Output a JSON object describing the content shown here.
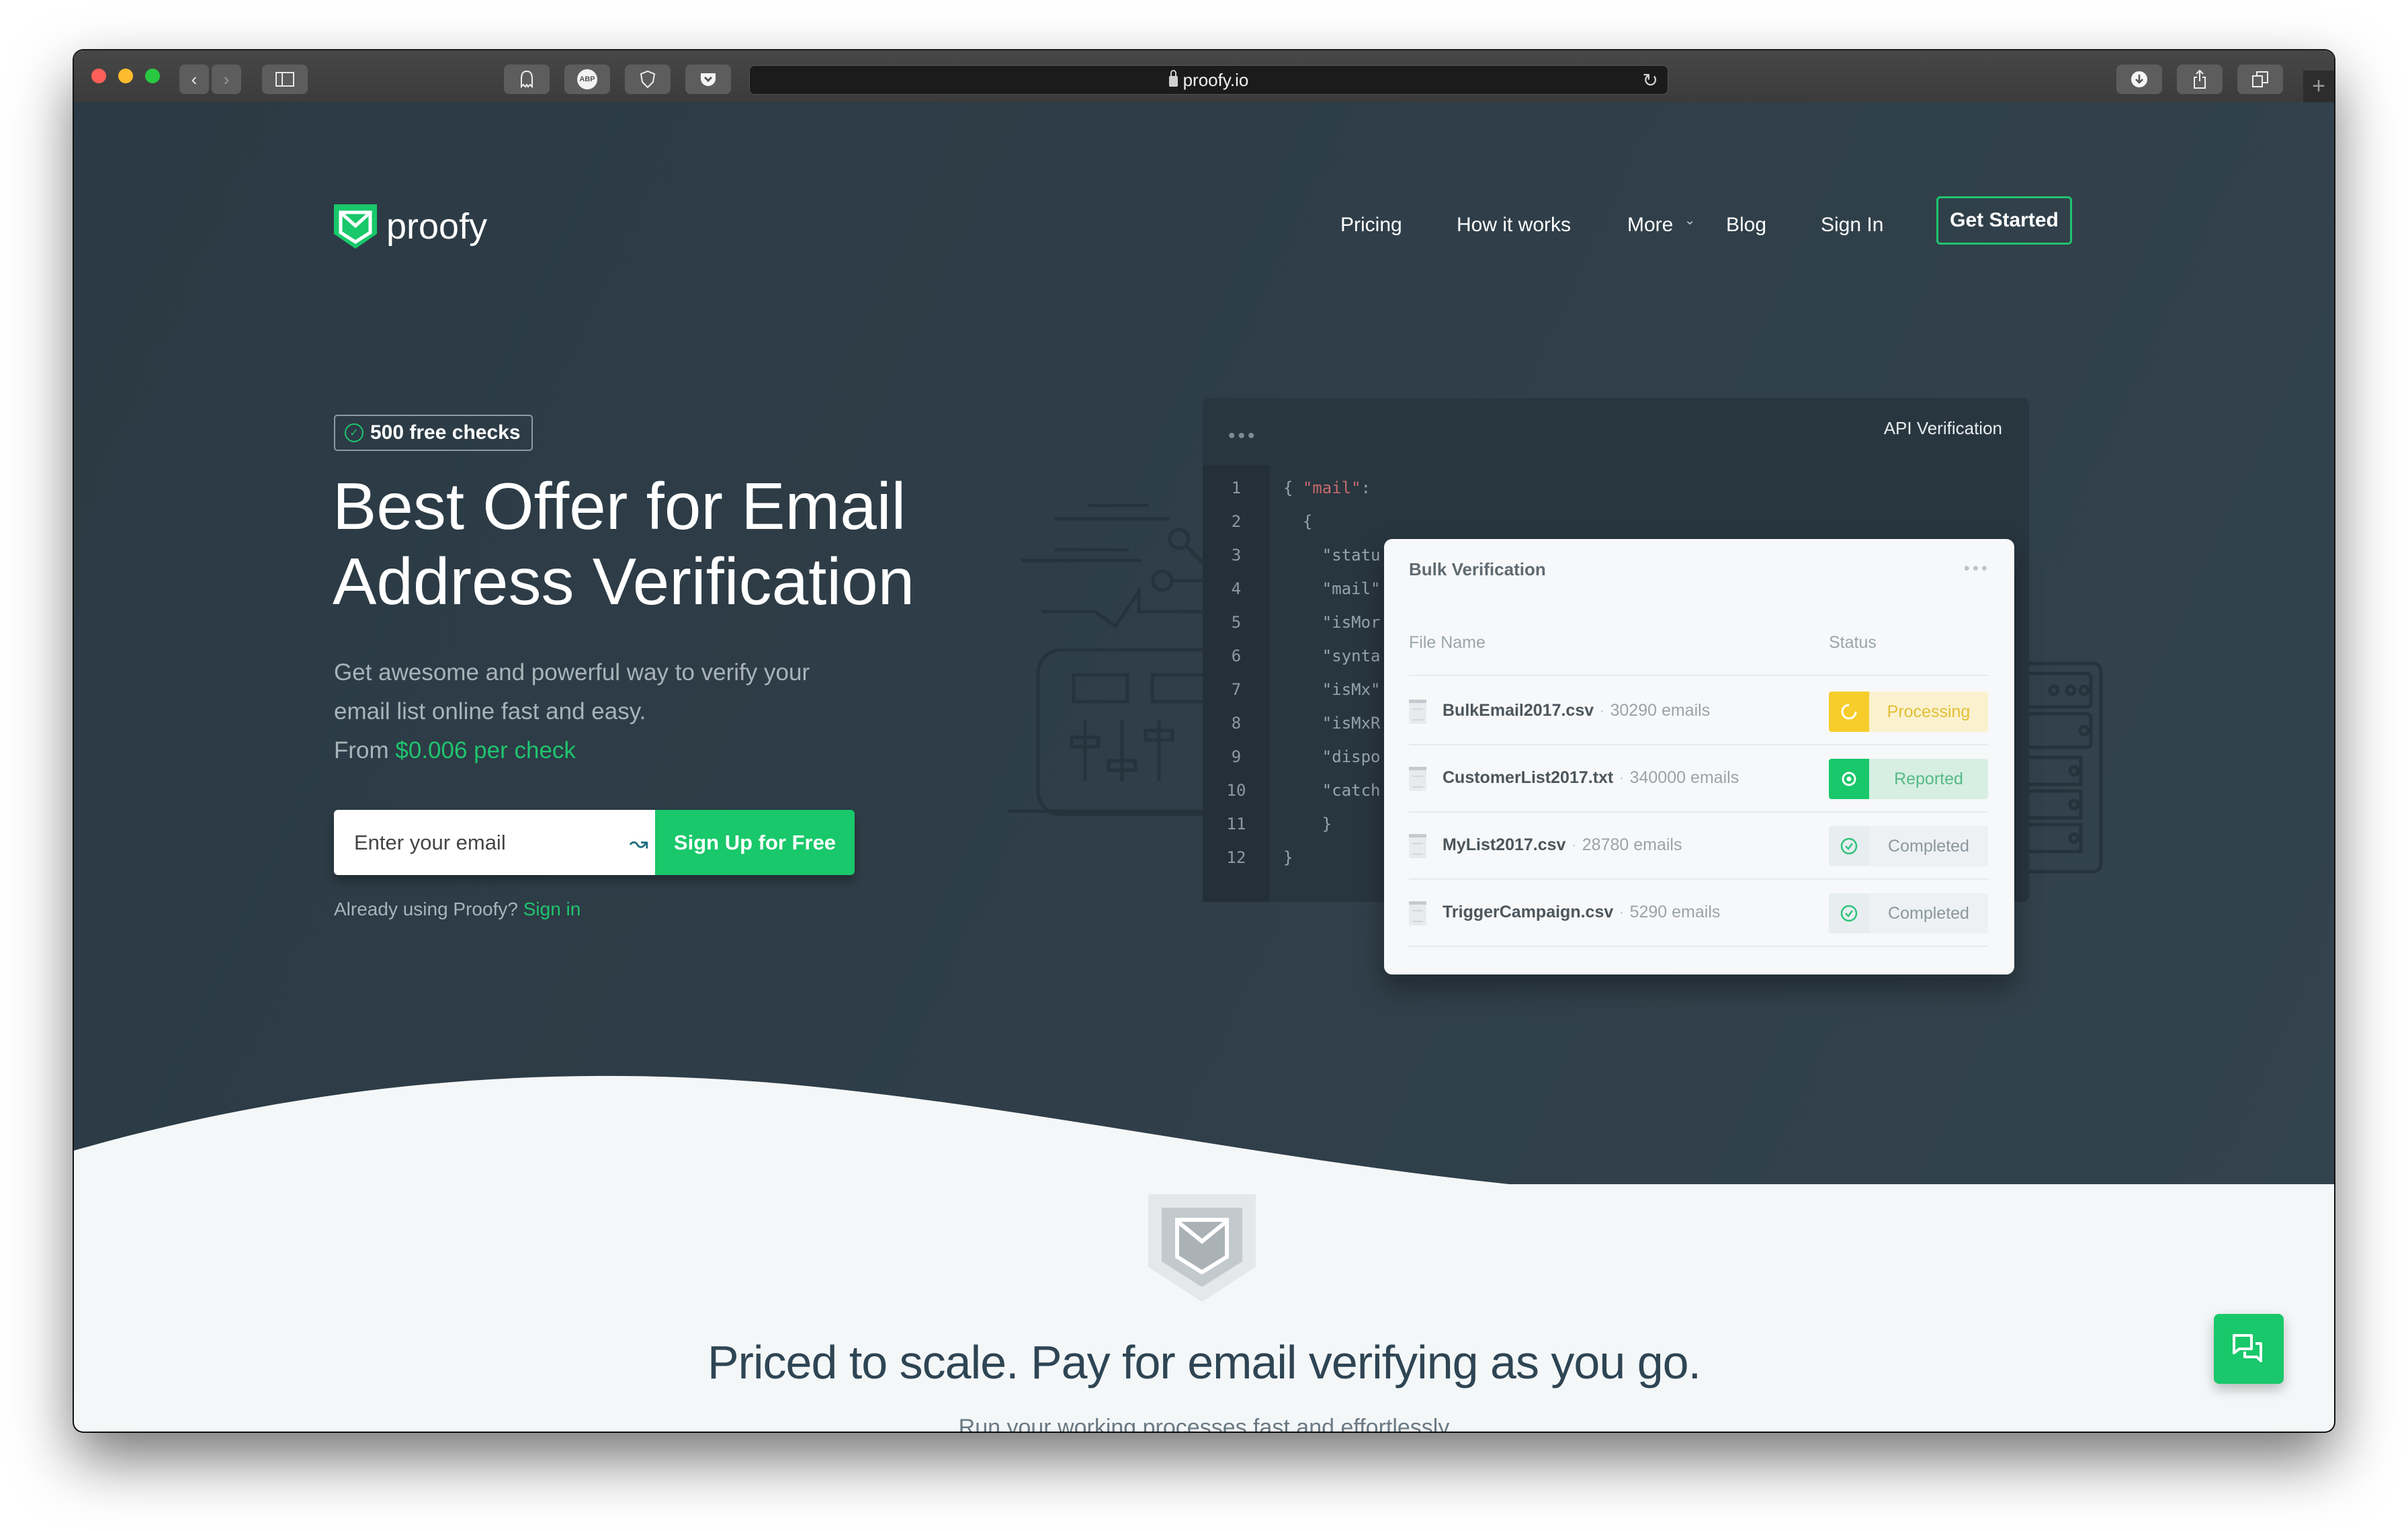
{
  "browser": {
    "url": "proofy.io",
    "extensions": [
      "ghostery-icon",
      "adblock-plus-icon",
      "privacy-shield-icon",
      "pocket-icon"
    ],
    "extension_labels": [
      "",
      "ABP",
      "",
      ""
    ],
    "toolbar_right": [
      "download-icon",
      "share-icon",
      "tabs-overview-icon"
    ]
  },
  "brand": {
    "name": "proofy",
    "accent": "#19c86a",
    "hero_bg": "#2e3d47"
  },
  "nav": {
    "items": [
      "Pricing",
      "How it works",
      "More",
      "Blog",
      "Sign In"
    ],
    "cta": "Get Started"
  },
  "hero": {
    "badge": "500 free checks",
    "headline_line1": "Best Offer for Email",
    "headline_line2": "Address Verification",
    "sub_line1": "Get awesome and powerful way to verify your",
    "sub_line2": "email list online fast and easy.",
    "price_prefix": "From ",
    "price": "$0.006 per check",
    "email_placeholder": "Enter your email",
    "signup_label": "Sign Up for Free",
    "already_text": "Already using Proofy? ",
    "signin_link": "Sign in"
  },
  "api_window": {
    "title": "API Verification",
    "line_numbers": [
      "1",
      "2",
      "3",
      "4",
      "5",
      "6",
      "7",
      "8",
      "9",
      "10",
      "11",
      "12"
    ],
    "code_lines": [
      {
        "pre": "{ ",
        "str": "\"mail\"",
        "post": ":"
      },
      {
        "pre": "  {",
        "str": "",
        "post": ""
      },
      {
        "pre": "    \"statu",
        "str": "",
        "post": ""
      },
      {
        "pre": "    \"mail\"",
        "str": "",
        "post": ""
      },
      {
        "pre": "    \"isMor",
        "str": "",
        "post": ""
      },
      {
        "pre": "    \"synta",
        "str": "",
        "post": ""
      },
      {
        "pre": "    \"isMx\"",
        "str": "",
        "post": ""
      },
      {
        "pre": "    \"isMxR",
        "str": "",
        "post": ""
      },
      {
        "pre": "    \"dispo",
        "str": "",
        "post": ""
      },
      {
        "pre": "    \"catch",
        "str": "",
        "post": ""
      },
      {
        "pre": "    }",
        "str": "",
        "post": ""
      },
      {
        "pre": "}",
        "str": "",
        "post": ""
      }
    ]
  },
  "bulk": {
    "title": "Bulk Verification",
    "columns": [
      "File Name",
      "Status"
    ],
    "rows": [
      {
        "file": "BulkEmail2017.csv",
        "count": "30290 emails",
        "status": "Processing",
        "kind": "processing"
      },
      {
        "file": "CustomerList2017.txt",
        "count": "340000 emails",
        "status": "Reported",
        "kind": "reported"
      },
      {
        "file": "MyList2017.csv",
        "count": "28780 emails",
        "status": "Completed",
        "kind": "completed"
      },
      {
        "file": "TriggerCampaign.csv",
        "count": "5290 emails",
        "status": "Completed",
        "kind": "completed"
      }
    ],
    "status_colors": {
      "processing": {
        "icon_bg": "#f7cd2c",
        "label_bg": "#fbf1cf",
        "label_fg": "#e1c032"
      },
      "reported": {
        "icon_bg": "#19c86a",
        "label_bg": "#d6efe2",
        "label_fg": "#56b887"
      },
      "completed": {
        "icon_bg": "#e8eef0",
        "label_bg": "#edf1f3",
        "label_fg": "#8a979e"
      }
    }
  },
  "pricing": {
    "title": "Priced to scale. Pay for email verifying as you go.",
    "subtitle": "Run your working processes fast and effortlessly"
  },
  "chat": {
    "icon": "chat-bubbles-icon"
  }
}
